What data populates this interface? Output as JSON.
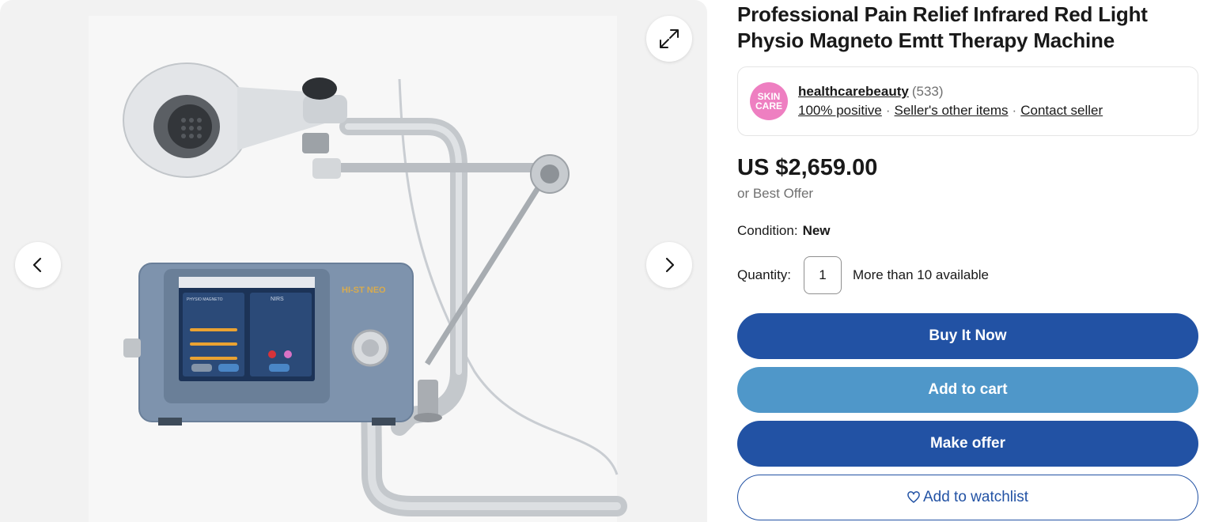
{
  "product": {
    "title": "Professional Pain Relief Infrared Red Light Physio Magneto Emtt Therapy Machine"
  },
  "gallery": {
    "prev_icon": "chevron-left-icon",
    "next_icon": "chevron-right-icon",
    "expand_icon": "expand-icon",
    "device_screen": {
      "header": "PHYSIO MAGNETO",
      "right_panel_title": "NIRS",
      "brand": "HI-ST NEO"
    }
  },
  "seller": {
    "logo_line1": "SKIN",
    "logo_line2": "CARE",
    "name": "healthcarebeauty",
    "feedback_count": "(533)",
    "positive": "100% positive",
    "other_items": "Seller's other items",
    "contact": "Contact seller"
  },
  "pricing": {
    "price": "US $2,659.00",
    "best_offer": "or Best Offer"
  },
  "condition": {
    "label": "Condition:",
    "value": "New"
  },
  "quantity": {
    "label": "Quantity:",
    "value": "1",
    "available": "More than 10 available"
  },
  "actions": {
    "buy_now": "Buy It Now",
    "add_to_cart": "Add to cart",
    "make_offer": "Make offer",
    "watchlist": "Add to watchlist"
  },
  "colors": {
    "primary_blue": "#2252a4",
    "cart_blue": "#4f97c9",
    "seller_logo_pink": "#ee7fc1",
    "gallery_bg": "#f2f2f2"
  }
}
